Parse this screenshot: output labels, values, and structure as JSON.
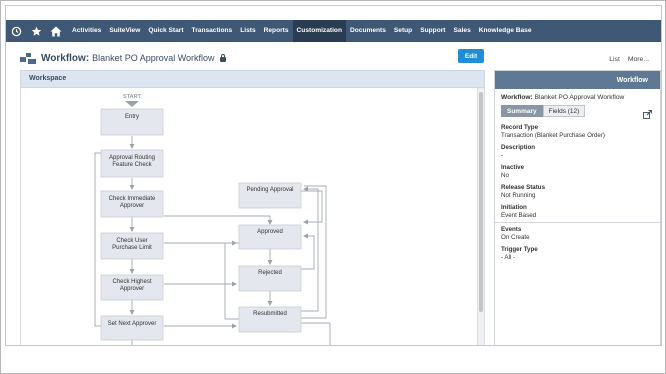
{
  "nav": {
    "icons": [
      "history-icon",
      "star-icon",
      "home-icon"
    ],
    "items": [
      "Activities",
      "SuiteView",
      "Quick Start",
      "Transactions",
      "Lists",
      "Reports",
      "Customization",
      "Documents",
      "Setup",
      "Support",
      "Sales",
      "Knowledge Base"
    ],
    "active": "Customization"
  },
  "header": {
    "record_type": "Workflow",
    "separator": ":",
    "record_name": "Blanket PO Approval Workflow",
    "edit_label": "Edit",
    "list_link": "List",
    "more_link": "More..."
  },
  "workspace": {
    "title": "Workspace",
    "start_label": "START",
    "states": {
      "entry": "Entry",
      "approval_routing_1": "Approval Routing",
      "approval_routing_2": "Feature Check",
      "check_immediate_1": "Check Immediate",
      "check_immediate_2": "Approver",
      "check_user_1": "Check User",
      "check_user_2": "Purchase Limit",
      "check_highest_1": "Check Highest",
      "check_highest_2": "Approver",
      "set_next": "Set Next Approver",
      "pending": "Pending Approval",
      "approved": "Approved",
      "rejected": "Rejected",
      "resubmitted": "Resubmitted"
    }
  },
  "panel": {
    "header": "Workflow",
    "name_label": "Workflow:",
    "name_value": "Blanket PO Approval Workflow",
    "tab_summary": "Summary",
    "tab_fields": "Fields (12)",
    "props": [
      {
        "label": "Record Type",
        "value": "Transaction (Blanket Purchase Order)"
      },
      {
        "label": "Description",
        "value": "-"
      },
      {
        "label": "Inactive",
        "value": "No"
      },
      {
        "label": "Release Status",
        "value": "Not Running"
      },
      {
        "label": "Initiation",
        "value": "Event Based"
      }
    ],
    "props2": [
      {
        "label": "Events",
        "value": "On Create"
      },
      {
        "label": "Trigger Type",
        "value": "- All -"
      }
    ]
  },
  "colors": {
    "nav_bg": "#3f5876",
    "nav_active": "#2a3c52",
    "state_fill": "#e4e7ee",
    "accent": "#1f8ed6"
  }
}
